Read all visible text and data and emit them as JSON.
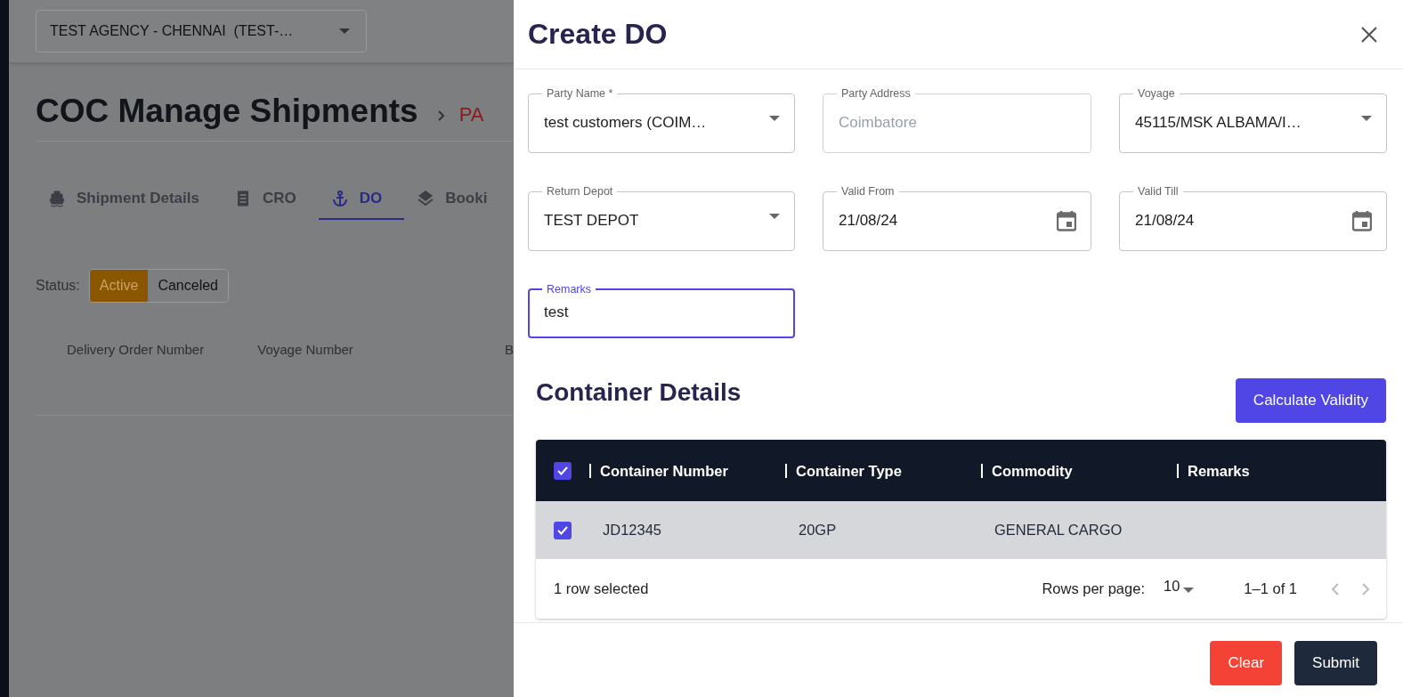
{
  "page": {
    "agency_select": {
      "value": "TEST AGENCY - CHENNAI  (TEST-…"
    },
    "title": "COC Manage Shipments",
    "breadcrumb": "PA",
    "tabs": [
      {
        "label": "Shipment Details",
        "selected": false
      },
      {
        "label": "CRO",
        "selected": false
      },
      {
        "label": "DO",
        "selected": true
      },
      {
        "label": "Booki",
        "selected": false
      }
    ],
    "status_label": "Status:",
    "status_options": [
      {
        "label": "Active",
        "selected": true
      },
      {
        "label": "Canceled",
        "selected": false
      }
    ],
    "columns": [
      "Delivery Order Number",
      "Voyage Number",
      "B"
    ]
  },
  "drawer": {
    "title": "Create DO",
    "fields": [
      {
        "kind": "select",
        "label": "Party Name *",
        "value": "test customers (COIM…",
        "disabled": false,
        "focused": false
      },
      {
        "kind": "text",
        "label": "Party Address",
        "value": "Coimbatore",
        "disabled": true,
        "focused": false
      },
      {
        "kind": "select",
        "label": "Voyage",
        "value": "45115/MSK ALBAMA/I…",
        "disabled": false,
        "focused": false
      },
      {
        "kind": "select",
        "label": "Return Depot",
        "value": "TEST DEPOT",
        "disabled": false,
        "focused": false
      },
      {
        "kind": "date",
        "label": "Valid From",
        "value": "21/08/24",
        "disabled": false,
        "focused": false
      },
      {
        "kind": "date",
        "label": "Valid Till",
        "value": "21/08/24",
        "disabled": false,
        "focused": false
      },
      {
        "kind": "text",
        "label": "Remarks",
        "value": "test",
        "disabled": false,
        "focused": true
      }
    ],
    "section_title": "Container Details",
    "calculate_button": "Calculate Validity",
    "table": {
      "select_all_checked": true,
      "columns": [
        "Container Number",
        "Container Type",
        "Commodity",
        "Remarks"
      ],
      "rows": [
        {
          "selected": true,
          "cells": [
            "JD12345",
            "20GP",
            "GENERAL CARGO",
            ""
          ]
        }
      ],
      "selection_text": "1 row selected",
      "rows_per_page_label": "Rows per page:",
      "rows_per_page": "10",
      "range": "1–1 of 1"
    },
    "buttons": [
      {
        "kind": "clear",
        "label": "Clear"
      },
      {
        "kind": "submit",
        "label": "Submit"
      }
    ]
  }
}
